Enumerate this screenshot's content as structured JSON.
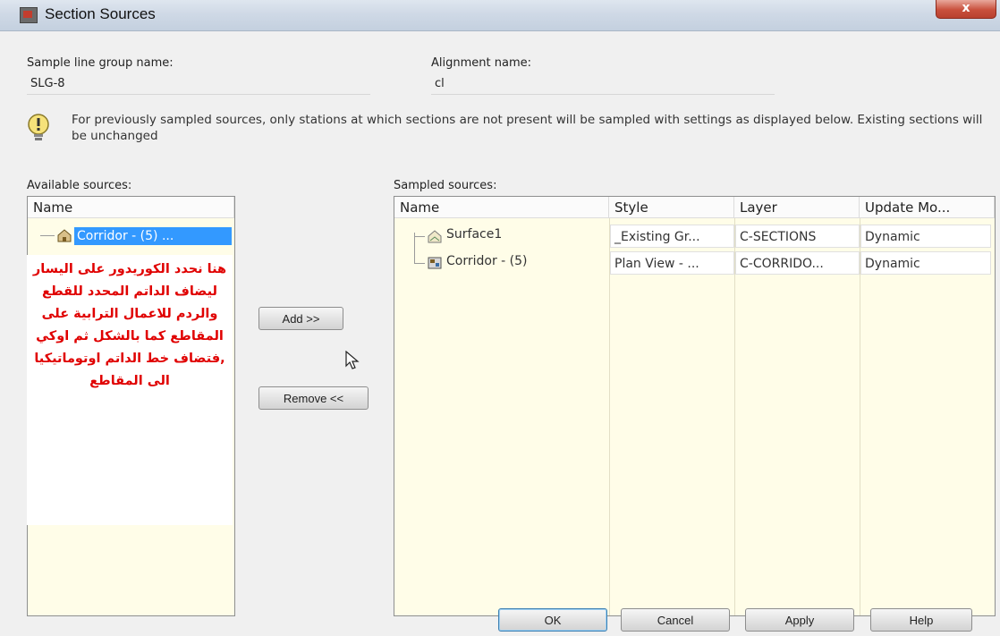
{
  "window": {
    "title": "Section Sources",
    "close_label": "x"
  },
  "sample_line_group": {
    "label": "Sample line group name:",
    "value": "SLG-8"
  },
  "alignment": {
    "label": "Alignment name:",
    "value": "cl"
  },
  "info_message": "For previously sampled sources, only stations at which sections are not present will be sampled with settings as displayed below. Existing sections will be unchanged",
  "available": {
    "label": "Available sources:",
    "header": "Name",
    "items": [
      {
        "name": "Corridor - (5) ..."
      }
    ]
  },
  "sampled": {
    "label": "Sampled sources:",
    "headers": [
      "Name",
      "Style",
      "Layer",
      "Update Mo..."
    ],
    "rows": [
      {
        "name": "Surface1",
        "style": "_Existing Gr...",
        "layer": "C-SECTIONS",
        "update": "Dynamic"
      },
      {
        "name": "Corridor - (5)",
        "style": "Plan View - ...",
        "layer": "C-CORRIDO...",
        "update": "Dynamic"
      }
    ]
  },
  "buttons": {
    "add": "Add >>",
    "remove": "Remove <<",
    "ok": "OK",
    "cancel": "Cancel",
    "apply": "Apply",
    "help": "Help"
  },
  "annotation": "هنا نحدد الكوريدور على اليسار ليضاف الداتم المحدد للقطع والردم للاعمال الترابية على المقاطع كما بالشكل ثم اوكي ,فتضاف خط الداتم اوتوماتيكيا الى المقاطع",
  "icons": {
    "warning": "lightbulb-warning-icon",
    "surface": "surface-icon",
    "corridor": "corridor-icon",
    "cursor": "mouse-pointer-icon"
  },
  "colors": {
    "selection": "#3399ff",
    "annotation_text": "#e00000",
    "panel_bg": "#fffde8"
  }
}
